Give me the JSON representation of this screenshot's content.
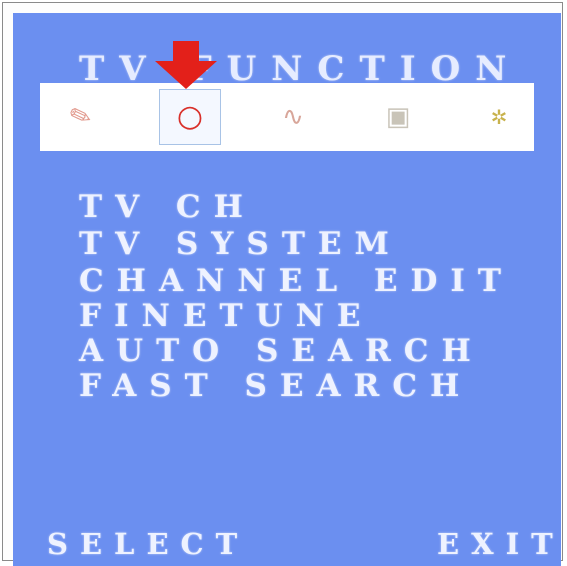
{
  "menu": {
    "title": "TV FUNCTION",
    "items": [
      "TV CH",
      "TV SYSTEM",
      "CHANNEL EDIT",
      "FINETUNE",
      "AUTO SEARCH",
      "FAST SEARCH"
    ],
    "selected_icon_index": 1
  },
  "icons": [
    {
      "name": "picture-icon",
      "glyph": "✎"
    },
    {
      "name": "tv-function-icon",
      "glyph": "○"
    },
    {
      "name": "sound-icon",
      "glyph": "∿"
    },
    {
      "name": "system-icon",
      "glyph": "▣"
    },
    {
      "name": "option-icon",
      "glyph": "✲"
    }
  ],
  "footer": {
    "select_label": "SELECT",
    "exit_label": "EXIT"
  },
  "colors": {
    "screen_bg": "#6b8ff0",
    "osd_text": "#eef2ff",
    "arrow": "#e3201a",
    "selected_icon": "#d9302a"
  }
}
